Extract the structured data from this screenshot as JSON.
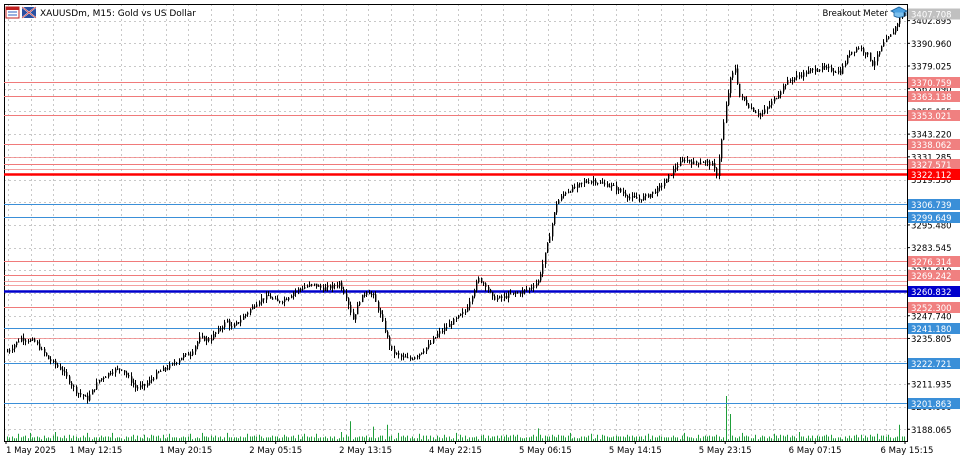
{
  "header": {
    "symbol_text": "XAUUSDm, M15:  Gold vs US Dollar",
    "indicator_name": "Breakout Meter",
    "header_icons": [
      "chart-window-icon",
      "symbol-flag-icon"
    ],
    "indicator_icon": "graduation-cap-icon"
  },
  "colors": {
    "background": "#ffffff",
    "grid": "#c8c8c8",
    "candle": "#000000",
    "volume": "#1f9e3a",
    "resistance_line": "#f07a7a",
    "resistance_label": "#f08080",
    "support_line": "#3a8fd8",
    "support_label": "#3a8fd8",
    "key_resistance": "#ff0000",
    "key_support": "#0000cc",
    "current_price": "#c0c0c0"
  },
  "chart_data": {
    "type": "candlestick",
    "symbol": "XAUUSDm",
    "timeframe": "M15",
    "ylim": [
      3184.0,
      3409.0
    ],
    "price_axis_ticks": [
      "3402.895",
      "3390.960",
      "3379.025",
      "3367.090",
      "3355.155",
      "3343.220",
      "3331.285",
      "3319.350",
      "3307.415",
      "3295.480",
      "3283.545",
      "3271.610",
      "3259.675",
      "3247.740",
      "3235.805",
      "3223.870",
      "3211.935",
      "3200.000",
      "3188.065"
    ],
    "time_axis_labels": [
      "1 May 2025",
      "1 May 12:15",
      "1 May 20:15",
      "2 May 05:15",
      "2 May 13:15",
      "4 May 22:15",
      "5 May 06:15",
      "5 May 14:15",
      "5 May 23:15",
      "6 May 07:15",
      "6 May 15:15"
    ],
    "current_price": "3407.708",
    "key_levels": [
      {
        "label": "3322.112",
        "kind": "key_resistance"
      },
      {
        "label": "3260.832",
        "kind": "key_support"
      }
    ],
    "levels": [
      {
        "label": "3370.759",
        "kind": "resistance"
      },
      {
        "label": "3363.138",
        "kind": "resistance"
      },
      {
        "label": "3353.021",
        "kind": "resistance"
      },
      {
        "label": "3338.062",
        "kind": "resistance"
      },
      {
        "label": "3327.571",
        "kind": "resistance"
      },
      {
        "label": "3306.739",
        "kind": "support"
      },
      {
        "label": "3299.649",
        "kind": "support"
      },
      {
        "label": "3276.314",
        "kind": "resistance"
      },
      {
        "label": "3269.242",
        "kind": "resistance"
      },
      {
        "label": "3252.300",
        "kind": "resistance"
      },
      {
        "label": "3241.180",
        "kind": "support"
      },
      {
        "label": "3222.721",
        "kind": "support"
      },
      {
        "label": "3201.863",
        "kind": "support"
      }
    ],
    "extra_lines": [
      3331.0,
      3325.0,
      3266.0,
      3264.0,
      3236.0
    ],
    "price_path": [
      [
        0,
        3229
      ],
      [
        6,
        3236
      ],
      [
        12,
        3234
      ],
      [
        18,
        3225
      ],
      [
        24,
        3219
      ],
      [
        30,
        3208
      ],
      [
        35,
        3204
      ],
      [
        40,
        3214
      ],
      [
        46,
        3219
      ],
      [
        50,
        3220
      ],
      [
        56,
        3210
      ],
      [
        60,
        3211
      ],
      [
        66,
        3218
      ],
      [
        72,
        3222
      ],
      [
        76,
        3226
      ],
      [
        80,
        3228
      ],
      [
        84,
        3236
      ],
      [
        88,
        3235
      ],
      [
        92,
        3240
      ],
      [
        96,
        3245
      ],
      [
        98,
        3241
      ],
      [
        102,
        3246
      ],
      [
        106,
        3251
      ],
      [
        110,
        3256
      ],
      [
        114,
        3258
      ],
      [
        118,
        3255
      ],
      [
        122,
        3257
      ],
      [
        126,
        3261
      ],
      [
        130,
        3263
      ],
      [
        134,
        3264
      ],
      [
        138,
        3262
      ],
      [
        142,
        3263
      ],
      [
        145,
        3265
      ],
      [
        148,
        3258
      ],
      [
        151,
        3246
      ],
      [
        154,
        3256
      ],
      [
        157,
        3261
      ],
      [
        160,
        3258
      ],
      [
        163,
        3248
      ],
      [
        166,
        3236
      ],
      [
        168,
        3229
      ],
      [
        172,
        3226
      ],
      [
        176,
        3225
      ],
      [
        180,
        3228
      ],
      [
        184,
        3232
      ],
      [
        188,
        3238
      ],
      [
        192,
        3242
      ],
      [
        196,
        3246
      ],
      [
        200,
        3250
      ],
      [
        204,
        3262
      ],
      [
        206,
        3267
      ],
      [
        209,
        3264
      ],
      [
        212,
        3257
      ],
      [
        216,
        3257
      ],
      [
        220,
        3259
      ],
      [
        224,
        3260
      ],
      [
        228,
        3262
      ],
      [
        232,
        3266
      ],
      [
        234,
        3275
      ],
      [
        236,
        3285
      ],
      [
        238,
        3296
      ],
      [
        240,
        3307
      ],
      [
        244,
        3313
      ],
      [
        248,
        3315
      ],
      [
        252,
        3318
      ],
      [
        256,
        3319
      ],
      [
        260,
        3317
      ],
      [
        264,
        3316
      ],
      [
        268,
        3313
      ],
      [
        272,
        3310
      ],
      [
        276,
        3309
      ],
      [
        280,
        3311
      ],
      [
        284,
        3314
      ],
      [
        288,
        3319
      ],
      [
        292,
        3326
      ],
      [
        296,
        3330
      ],
      [
        300,
        3328
      ],
      [
        304,
        3329
      ],
      [
        308,
        3327
      ],
      [
        310,
        3322
      ],
      [
        312,
        3340
      ],
      [
        314,
        3358
      ],
      [
        316,
        3372
      ],
      [
        318,
        3378
      ],
      [
        320,
        3363
      ],
      [
        322,
        3361
      ],
      [
        324,
        3358
      ],
      [
        326,
        3356
      ],
      [
        328,
        3354
      ],
      [
        330,
        3354
      ],
      [
        332,
        3357
      ],
      [
        336,
        3363
      ],
      [
        340,
        3370
      ],
      [
        344,
        3373
      ],
      [
        348,
        3375
      ],
      [
        352,
        3377
      ],
      [
        356,
        3378
      ],
      [
        360,
        3377
      ],
      [
        364,
        3376
      ],
      [
        368,
        3386
      ],
      [
        372,
        3389
      ],
      [
        376,
        3385
      ],
      [
        378,
        3380
      ],
      [
        380,
        3384
      ],
      [
        383,
        3391
      ],
      [
        386,
        3395
      ],
      [
        390,
        3404
      ],
      [
        392,
        3407
      ]
    ],
    "volume_pattern": [
      3,
      2,
      4,
      2,
      3,
      5,
      2,
      3,
      4,
      2,
      6,
      3,
      2,
      4,
      3,
      2,
      5,
      3,
      4,
      2,
      3,
      7,
      2,
      4,
      3
    ],
    "volume_spikes": [
      [
        150,
        22
      ],
      [
        160,
        16
      ],
      [
        166,
        18
      ],
      [
        232,
        14
      ],
      [
        314,
        50
      ],
      [
        316,
        30
      ],
      [
        390,
        18
      ]
    ]
  }
}
